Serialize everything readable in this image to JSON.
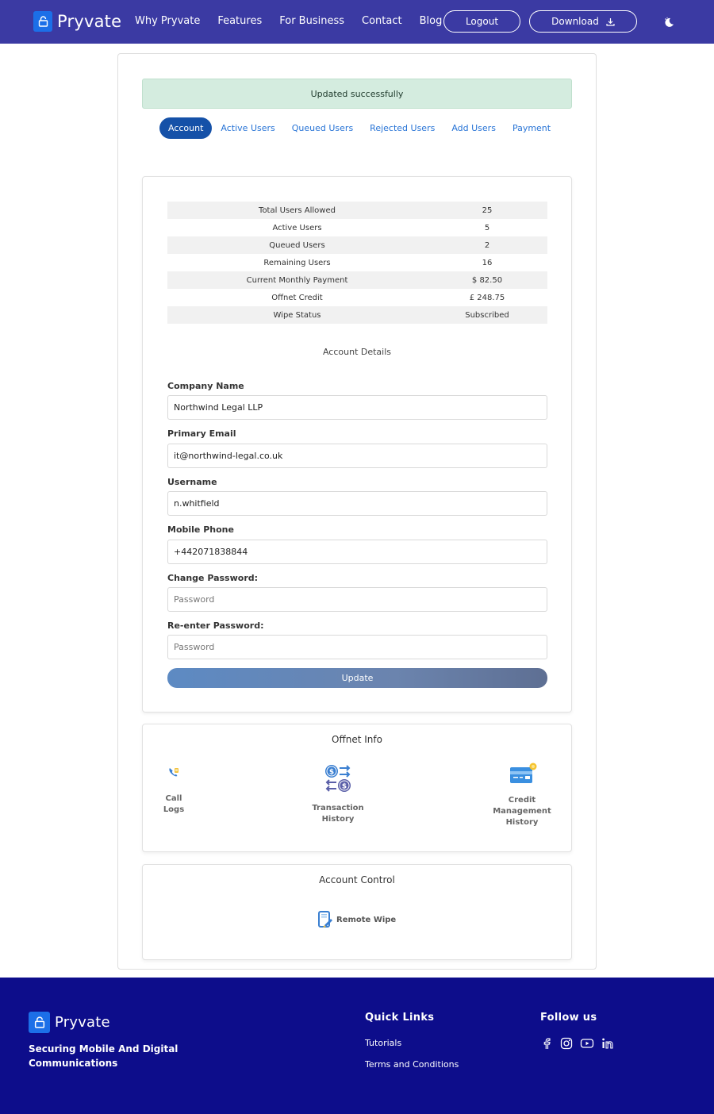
{
  "nav": {
    "brand": "Pryvate",
    "links": [
      "Why Pryvate",
      "Features",
      "For Business",
      "Contact",
      "Blog"
    ],
    "logout": "Logout",
    "download": "Download"
  },
  "alert": "Updated successfully",
  "tabs": [
    "Account",
    "Active Users",
    "Queued Users",
    "Rejected Users",
    "Add Users",
    "Payment"
  ],
  "stats": [
    {
      "label": "Total Users Allowed",
      "value": "25"
    },
    {
      "label": "Active Users",
      "value": "5"
    },
    {
      "label": "Queued Users",
      "value": "2"
    },
    {
      "label": "Remaining Users",
      "value": "16"
    },
    {
      "label": "Current Monthly Payment",
      "value": "$ 82.50"
    },
    {
      "label": "Offnet Credit",
      "value": "£ 248.75"
    },
    {
      "label": "Wipe Status",
      "value": "Subscribed"
    }
  ],
  "account": {
    "title": "Account Details",
    "company_label": "Company Name",
    "company_value": "Northwind Legal LLP",
    "email_label": "Primary Email",
    "email_value": "it@northwind-legal.co.uk",
    "username_label": "Username",
    "username_value": "n.whitfield",
    "phone_label": "Mobile Phone",
    "phone_value": "+442071838844",
    "password_label": "Change Password:",
    "password_placeholder": "Password",
    "repassword_label": "Re-enter Password:",
    "repassword_placeholder": "Password",
    "update": "Update"
  },
  "offnet": {
    "title": "Offnet Info",
    "call_logs_1": "Call",
    "call_logs_2": "Logs",
    "transaction_1": "Transaction",
    "transaction_2": "History",
    "credit_1": "Credit",
    "credit_2": "Management",
    "credit_3": "History"
  },
  "control": {
    "title": "Account Control",
    "remote_wipe": "Remote Wipe"
  },
  "footer": {
    "brand": "Pryvate",
    "tagline": "Securing Mobile And Digital Communications",
    "quick_links": "Quick Links",
    "links": [
      "Tutorials",
      "Terms and Conditions"
    ],
    "follow": "Follow us"
  },
  "colors": {
    "navbar": "#3b3aa3",
    "footer": "#0d0d8b",
    "accent": "#2874d6",
    "tab_active": "#1551a8",
    "alert_bg": "#d4ecdf"
  }
}
